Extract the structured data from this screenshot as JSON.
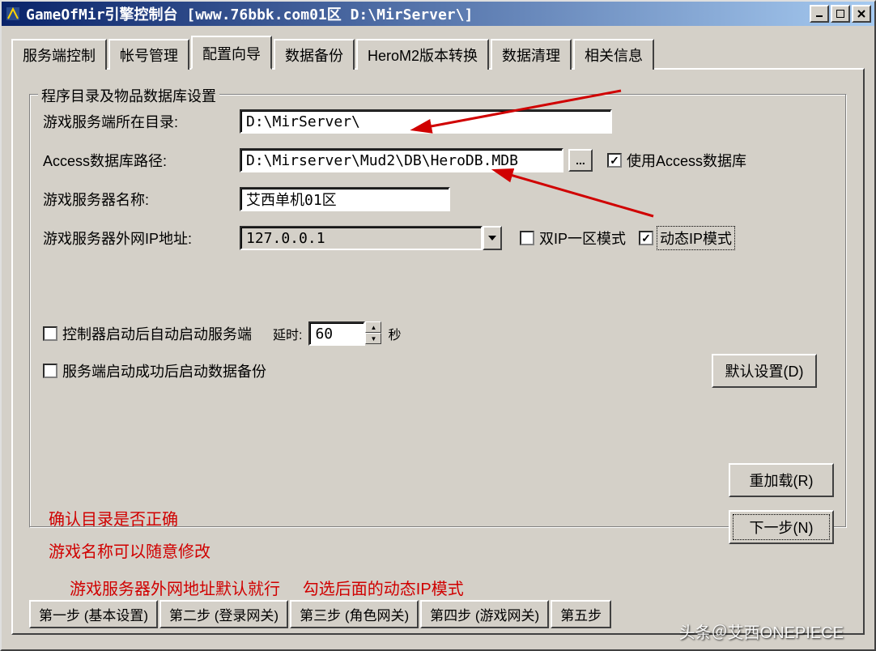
{
  "window": {
    "title": "GameOfMir引擎控制台  [www.76bbk.com01区  D:\\MirServer\\]"
  },
  "tabs": [
    "服务端控制",
    "帐号管理",
    "配置向导",
    "数据备份",
    "HeroM2版本转换",
    "数据清理",
    "相关信息"
  ],
  "active_tab_index": 2,
  "fieldset": {
    "legend": "程序目录及物品数据库设置",
    "labels": {
      "server_dir": "游戏服务端所在目录:",
      "access_path": "Access数据库路径:",
      "server_name": "游戏服务器名称:",
      "external_ip": "游戏服务器外网IP地址:"
    },
    "values": {
      "server_dir": "D:\\MirServer\\",
      "access_path": "D:\\Mirserver\\Mud2\\DB\\HeroDB.MDB",
      "server_name": "艾西单机01区",
      "external_ip": "127.0.0.1"
    },
    "checkboxes": {
      "use_access": {
        "label": "使用Access数据库",
        "checked": true
      },
      "dual_ip": {
        "label": "双IP一区模式",
        "checked": false
      },
      "dyn_ip": {
        "label": "动态IP模式",
        "checked": true
      },
      "auto_start": {
        "label": "控制器启动后自动启动服务端",
        "checked": false
      },
      "auto_backup": {
        "label": "服务端启动成功后启动数据备份",
        "checked": false
      }
    },
    "delay": {
      "label_prefix": "延时:",
      "value": "60",
      "label_suffix": "秒"
    },
    "browse_btn": "..."
  },
  "buttons": {
    "default_settings": "默认设置(D)",
    "reload": "重加载(R)",
    "next_step": "下一步(N)"
  },
  "notes": {
    "line1": "确认目录是否正确",
    "line2": "游戏名称可以随意修改",
    "line3a": "游戏服务器外网地址默认就行",
    "line3b": "勾选后面的动态IP模式"
  },
  "bottom_tabs": [
    "第一步 (基本设置)",
    "第二步 (登录网关)",
    "第三步 (角色网关)",
    "第四步 (游戏网关)",
    "第五步"
  ],
  "watermark": "头条＠艾西ONEPIECE"
}
